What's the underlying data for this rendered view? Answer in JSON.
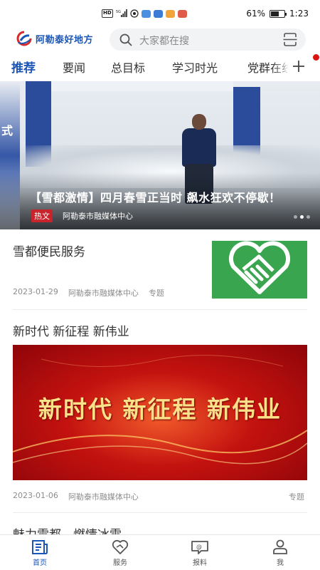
{
  "status_bar": {
    "network": "5G",
    "hd": "HD",
    "battery_text": "61%",
    "battery_level": 0.61,
    "time": "1:23"
  },
  "header": {
    "logo_text": "阿勒泰好地方",
    "search_placeholder": "大家都在搜"
  },
  "tabs": [
    {
      "label": "推荐",
      "active": true
    },
    {
      "label": "要闻",
      "active": false
    },
    {
      "label": "总目标",
      "active": false
    },
    {
      "label": "学习时光",
      "active": false
    },
    {
      "label": "党群在线",
      "active": false
    }
  ],
  "hero": {
    "side_text": "式",
    "title": "【雪都激情】四月春雪正当时 飙水狂欢不停歇！",
    "tag": "热文",
    "source": "阿勒泰市融媒体中心",
    "slides_total": 3,
    "slide_active": 1
  },
  "articles": [
    {
      "title": "雪都便民服务",
      "date": "2023-01-29",
      "source": "阿勒泰市融媒体中心",
      "tag": "专题"
    },
    {
      "title": "新时代 新征程 新伟业",
      "image_text": "新时代 新征程 新伟业",
      "date": "2023-01-06",
      "source": "阿勒泰市融媒体中心",
      "tag": "专题"
    },
    {
      "title": "魅力雪都，燃情冰雪"
    }
  ],
  "bottom_nav": [
    {
      "label": "首页",
      "icon": "home-news-icon",
      "active": true
    },
    {
      "label": "服务",
      "icon": "heart-service-icon",
      "active": false
    },
    {
      "label": "报料",
      "icon": "report-chat-icon",
      "active": false
    },
    {
      "label": "我",
      "icon": "person-icon",
      "active": false
    }
  ],
  "colors": {
    "brand_blue": "#1b56b6",
    "hot_tag_red": "#c9242b",
    "service_green": "#3aa54f"
  }
}
